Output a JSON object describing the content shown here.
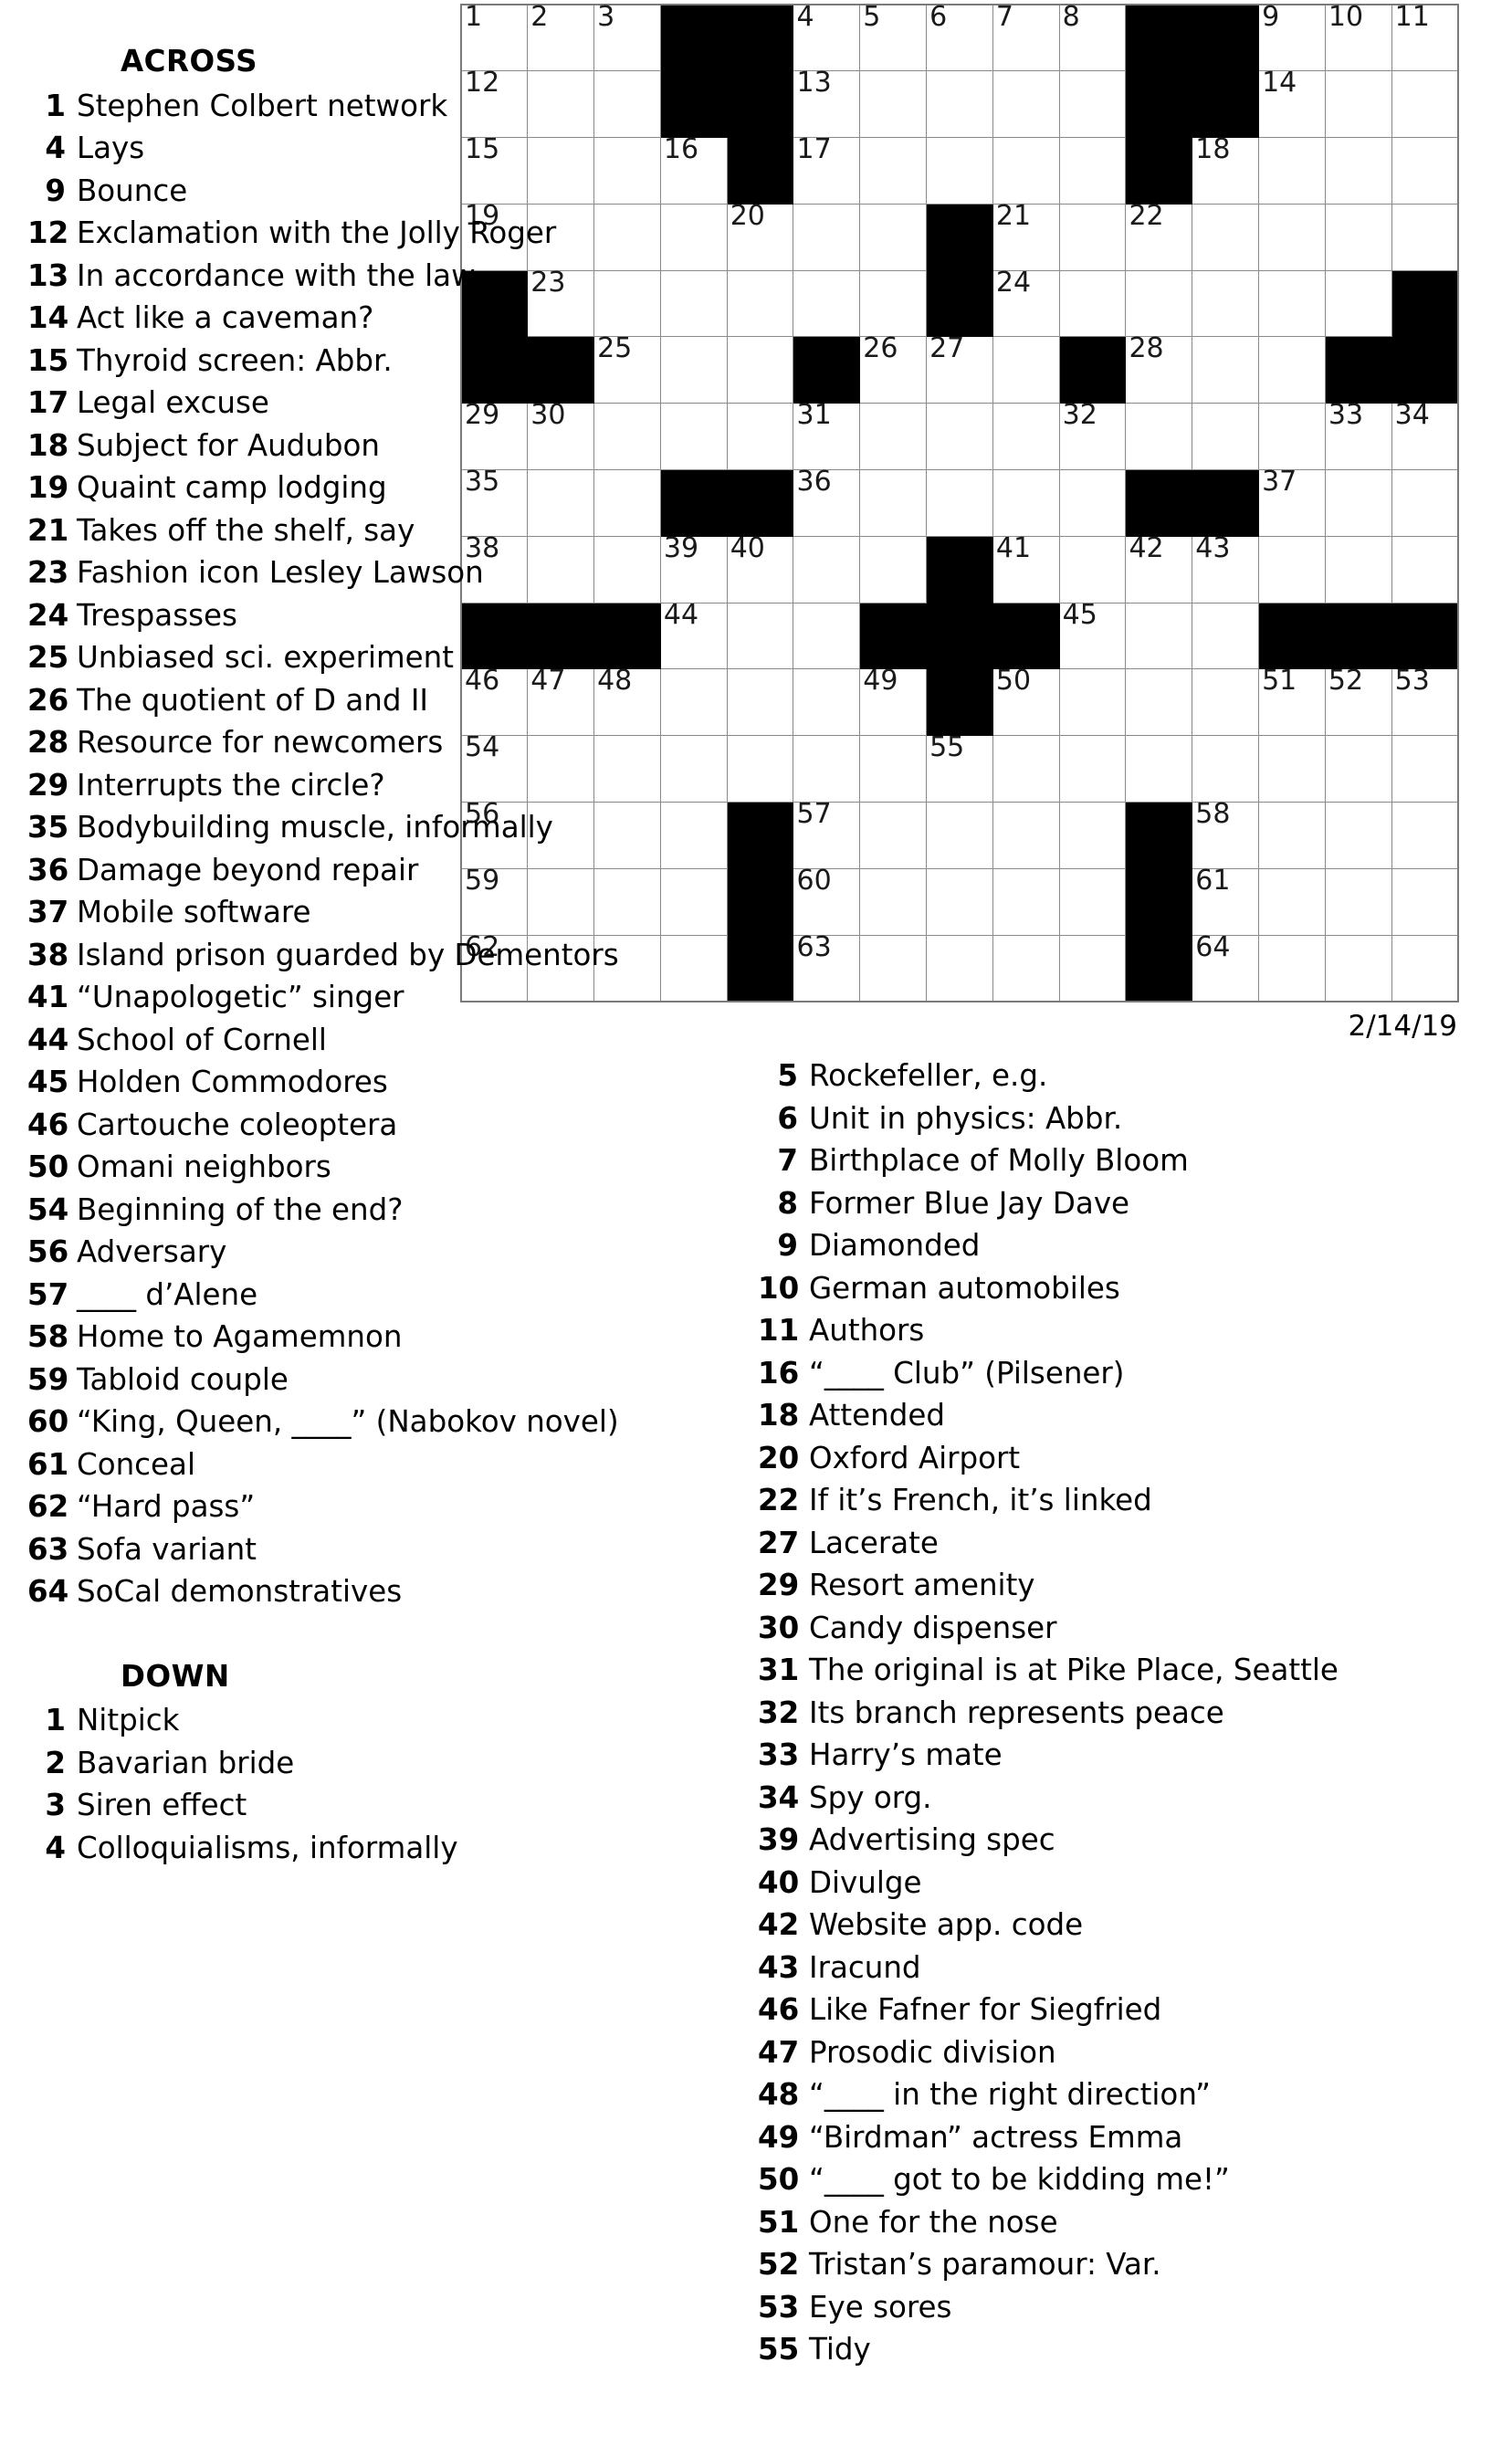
{
  "puzzle": {
    "date_label": "2/14/19",
    "grid_size": {
      "rows": 15,
      "cols": 15
    },
    "grid": [
      [
        {
          "n": "1"
        },
        {
          "n": "2"
        },
        {
          "n": "3"
        },
        {
          "b": 1
        },
        {
          "b": 1
        },
        {
          "n": "4"
        },
        {
          "n": "5"
        },
        {
          "n": "6"
        },
        {
          "n": "7"
        },
        {
          "n": "8"
        },
        {
          "b": 1
        },
        {
          "b": 1
        },
        {
          "n": "9"
        },
        {
          "n": "10"
        },
        {
          "n": "11"
        }
      ],
      [
        {
          "n": "12"
        },
        {},
        {},
        {
          "b": 1
        },
        {
          "b": 1
        },
        {
          "n": "13"
        },
        {},
        {},
        {},
        {},
        {
          "b": 1
        },
        {
          "b": 1
        },
        {
          "n": "14"
        },
        {},
        {}
      ],
      [
        {
          "n": "15"
        },
        {},
        {},
        {
          "n": "16"
        },
        {
          "b": 1
        },
        {
          "n": "17"
        },
        {},
        {},
        {},
        {},
        {
          "b": 1
        },
        {
          "n": "18"
        },
        {},
        {},
        {}
      ],
      [
        {
          "n": "19"
        },
        {},
        {},
        {},
        {
          "n": "20"
        },
        {},
        {},
        {
          "b": 1
        },
        {
          "n": "21"
        },
        {},
        {
          "n": "22"
        },
        {},
        {},
        {},
        {}
      ],
      [
        {
          "b": 1
        },
        {
          "n": "23"
        },
        {},
        {},
        {},
        {},
        {},
        {
          "b": 1
        },
        {
          "n": "24"
        },
        {},
        {},
        {},
        {},
        {},
        {
          "b": 1
        }
      ],
      [
        {
          "b": 1
        },
        {
          "b": 1
        },
        {
          "n": "25"
        },
        {},
        {},
        {
          "b": 1
        },
        {
          "n": "26"
        },
        {
          "n": "27"
        },
        {},
        {
          "b": 1
        },
        {
          "n": "28"
        },
        {},
        {},
        {
          "b": 1
        },
        {
          "b": 1
        }
      ],
      [
        {
          "n": "29"
        },
        {
          "n": "30"
        },
        {},
        {},
        {},
        {
          "n": "31"
        },
        {},
        {},
        {},
        {
          "n": "32"
        },
        {},
        {},
        {},
        {
          "n": "33"
        },
        {
          "n": "34"
        }
      ],
      [
        {
          "n": "35"
        },
        {},
        {},
        {
          "b": 1
        },
        {
          "b": 1
        },
        {
          "n": "36"
        },
        {},
        {},
        {},
        {},
        {
          "b": 1
        },
        {
          "b": 1
        },
        {
          "n": "37"
        },
        {},
        {}
      ],
      [
        {
          "n": "38"
        },
        {},
        {},
        {
          "n": "39"
        },
        {
          "n": "40"
        },
        {},
        {},
        {
          "b": 1
        },
        {
          "n": "41"
        },
        {},
        {
          "n": "42"
        },
        {
          "n": "43"
        },
        {},
        {},
        {}
      ],
      [
        {
          "b": 1
        },
        {
          "b": 1
        },
        {
          "b": 1
        },
        {
          "n": "44"
        },
        {},
        {},
        {
          "b": 1
        },
        {
          "b": 1
        },
        {
          "b": 1
        },
        {
          "n": "45"
        },
        {},
        {},
        {
          "b": 1
        },
        {
          "b": 1
        },
        {
          "b": 1
        }
      ],
      [
        {
          "n": "46"
        },
        {
          "n": "47"
        },
        {
          "n": "48"
        },
        {},
        {},
        {},
        {
          "n": "49"
        },
        {
          "b": 1
        },
        {
          "n": "50"
        },
        {},
        {},
        {},
        {
          "n": "51"
        },
        {
          "n": "52"
        },
        {
          "n": "53"
        }
      ],
      [
        {
          "n": "54"
        },
        {},
        {},
        {},
        {},
        {},
        {},
        {
          "n": "55"
        },
        {},
        {},
        {},
        {},
        {},
        {},
        {}
      ],
      [
        {
          "n": "56"
        },
        {},
        {},
        {},
        {
          "b": 1
        },
        {
          "n": "57"
        },
        {},
        {},
        {},
        {},
        {
          "b": 1
        },
        {
          "n": "58"
        },
        {},
        {},
        {}
      ],
      [
        {
          "n": "59"
        },
        {},
        {},
        {},
        {
          "b": 1
        },
        {
          "n": "60"
        },
        {},
        {},
        {},
        {},
        {
          "b": 1
        },
        {
          "n": "61"
        },
        {},
        {},
        {}
      ],
      [
        {
          "n": "62"
        },
        {},
        {},
        {},
        {
          "b": 1
        },
        {
          "n": "63"
        },
        {},
        {},
        {},
        {},
        {
          "b": 1
        },
        {
          "n": "64"
        },
        {},
        {},
        {}
      ]
    ]
  },
  "across": {
    "heading": "ACROSS",
    "clues": [
      {
        "num": "1",
        "text": "Stephen Colbert network"
      },
      {
        "num": "4",
        "text": "Lays"
      },
      {
        "num": "9",
        "text": "Bounce"
      },
      {
        "num": "12",
        "text": "Exclamation with the Jolly Roger"
      },
      {
        "num": "13",
        "text": "In accordance with the law"
      },
      {
        "num": "14",
        "text": "Act like a caveman?"
      },
      {
        "num": "15",
        "text": "Thyroid screen: Abbr."
      },
      {
        "num": "17",
        "text": "Legal excuse"
      },
      {
        "num": "18",
        "text": "Subject for Audubon"
      },
      {
        "num": "19",
        "text": "Quaint camp lodging"
      },
      {
        "num": "21",
        "text": "Takes off the shelf, say"
      },
      {
        "num": "23",
        "text": "Fashion icon Lesley Lawson"
      },
      {
        "num": "24",
        "text": "Trespasses"
      },
      {
        "num": "25",
        "text": "Unbiased sci. experiment"
      },
      {
        "num": "26",
        "text": "The quotient of D and II"
      },
      {
        "num": "28",
        "text": "Resource for newcomers"
      },
      {
        "num": "29",
        "text": "Interrupts the circle?"
      },
      {
        "num": "35",
        "text": "Bodybuilding muscle, informally"
      },
      {
        "num": "36",
        "text": "Damage beyond repair"
      },
      {
        "num": "37",
        "text": "Mobile software"
      },
      {
        "num": "38",
        "text": "Island prison guarded by Dementors"
      },
      {
        "num": "41",
        "text": "“Unapologetic” singer"
      },
      {
        "num": "44",
        "text": "School of Cornell"
      },
      {
        "num": "45",
        "text": "Holden Commodores"
      },
      {
        "num": "46",
        "text": "Cartouche coleoptera"
      },
      {
        "num": "50",
        "text": "Omani neighbors"
      },
      {
        "num": "54",
        "text": "Beginning of the end?"
      },
      {
        "num": "56",
        "text": "Adversary"
      },
      {
        "num": "57",
        "text": "____ d’Alene"
      },
      {
        "num": "58",
        "text": "Home to Agamemnon"
      },
      {
        "num": "59",
        "text": "Tabloid couple"
      },
      {
        "num": "60",
        "text": "“King, Queen, ____” (Nabokov novel)"
      },
      {
        "num": "61",
        "text": "Conceal"
      },
      {
        "num": "62",
        "text": "“Hard pass”"
      },
      {
        "num": "63",
        "text": "Sofa variant"
      },
      {
        "num": "64",
        "text": "SoCal demonstratives"
      }
    ]
  },
  "down": {
    "heading": "DOWN",
    "clues_left": [
      {
        "num": "1",
        "text": "Nitpick"
      },
      {
        "num": "2",
        "text": "Bavarian bride"
      },
      {
        "num": "3",
        "text": "Siren effect"
      },
      {
        "num": "4",
        "text": "Colloquialisms, informally"
      }
    ],
    "clues_right": [
      {
        "num": "5",
        "text": "Rockefeller, e.g."
      },
      {
        "num": "6",
        "text": "Unit in physics: Abbr."
      },
      {
        "num": "7",
        "text": "Birthplace of Molly Bloom"
      },
      {
        "num": "8",
        "text": "Former Blue Jay Dave"
      },
      {
        "num": "9",
        "text": "Diamonded"
      },
      {
        "num": "10",
        "text": "German automobiles"
      },
      {
        "num": "11",
        "text": "Authors"
      },
      {
        "num": "16",
        "text": "“____ Club” (Pilsener)"
      },
      {
        "num": "18",
        "text": "Attended"
      },
      {
        "num": "20",
        "text": "Oxford Airport"
      },
      {
        "num": "22",
        "text": "If it’s French, it’s linked"
      },
      {
        "num": "27",
        "text": "Lacerate"
      },
      {
        "num": "29",
        "text": "Resort amenity"
      },
      {
        "num": "30",
        "text": "Candy dispenser"
      },
      {
        "num": "31",
        "text": "The original is at Pike Place, Seattle"
      },
      {
        "num": "32",
        "text": "Its branch represents peace"
      },
      {
        "num": "33",
        "text": "Harry’s mate"
      },
      {
        "num": "34",
        "text": "Spy org."
      },
      {
        "num": "39",
        "text": "Advertising spec"
      },
      {
        "num": "40",
        "text": "Divulge"
      },
      {
        "num": "42",
        "text": "Website app. code"
      },
      {
        "num": "43",
        "text": "Iracund"
      },
      {
        "num": "46",
        "text": "Like Fafner for Siegfried"
      },
      {
        "num": "47",
        "text": "Prosodic division"
      },
      {
        "num": "48",
        "text": "“____ in the right direction”"
      },
      {
        "num": "49",
        "text": "“Birdman” actress Emma"
      },
      {
        "num": "50",
        "text": "“____ got to be kidding me!”"
      },
      {
        "num": "51",
        "text": "One for the nose"
      },
      {
        "num": "52",
        "text": "Tristan’s paramour: Var."
      },
      {
        "num": "53",
        "text": "Eye sores"
      },
      {
        "num": "55",
        "text": "Tidy"
      }
    ]
  }
}
